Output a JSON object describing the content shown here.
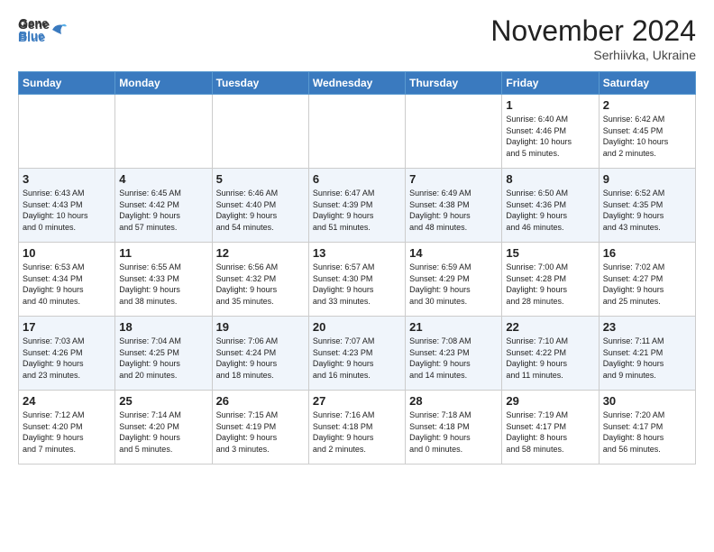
{
  "logo": {
    "general": "General",
    "blue": "Blue"
  },
  "title": "November 2024",
  "location": "Serhiivka, Ukraine",
  "headers": [
    "Sunday",
    "Monday",
    "Tuesday",
    "Wednesday",
    "Thursday",
    "Friday",
    "Saturday"
  ],
  "weeks": [
    [
      {
        "day": "",
        "info": ""
      },
      {
        "day": "",
        "info": ""
      },
      {
        "day": "",
        "info": ""
      },
      {
        "day": "",
        "info": ""
      },
      {
        "day": "",
        "info": ""
      },
      {
        "day": "1",
        "info": "Sunrise: 6:40 AM\nSunset: 4:46 PM\nDaylight: 10 hours\nand 5 minutes."
      },
      {
        "day": "2",
        "info": "Sunrise: 6:42 AM\nSunset: 4:45 PM\nDaylight: 10 hours\nand 2 minutes."
      }
    ],
    [
      {
        "day": "3",
        "info": "Sunrise: 6:43 AM\nSunset: 4:43 PM\nDaylight: 10 hours\nand 0 minutes."
      },
      {
        "day": "4",
        "info": "Sunrise: 6:45 AM\nSunset: 4:42 PM\nDaylight: 9 hours\nand 57 minutes."
      },
      {
        "day": "5",
        "info": "Sunrise: 6:46 AM\nSunset: 4:40 PM\nDaylight: 9 hours\nand 54 minutes."
      },
      {
        "day": "6",
        "info": "Sunrise: 6:47 AM\nSunset: 4:39 PM\nDaylight: 9 hours\nand 51 minutes."
      },
      {
        "day": "7",
        "info": "Sunrise: 6:49 AM\nSunset: 4:38 PM\nDaylight: 9 hours\nand 48 minutes."
      },
      {
        "day": "8",
        "info": "Sunrise: 6:50 AM\nSunset: 4:36 PM\nDaylight: 9 hours\nand 46 minutes."
      },
      {
        "day": "9",
        "info": "Sunrise: 6:52 AM\nSunset: 4:35 PM\nDaylight: 9 hours\nand 43 minutes."
      }
    ],
    [
      {
        "day": "10",
        "info": "Sunrise: 6:53 AM\nSunset: 4:34 PM\nDaylight: 9 hours\nand 40 minutes."
      },
      {
        "day": "11",
        "info": "Sunrise: 6:55 AM\nSunset: 4:33 PM\nDaylight: 9 hours\nand 38 minutes."
      },
      {
        "day": "12",
        "info": "Sunrise: 6:56 AM\nSunset: 4:32 PM\nDaylight: 9 hours\nand 35 minutes."
      },
      {
        "day": "13",
        "info": "Sunrise: 6:57 AM\nSunset: 4:30 PM\nDaylight: 9 hours\nand 33 minutes."
      },
      {
        "day": "14",
        "info": "Sunrise: 6:59 AM\nSunset: 4:29 PM\nDaylight: 9 hours\nand 30 minutes."
      },
      {
        "day": "15",
        "info": "Sunrise: 7:00 AM\nSunset: 4:28 PM\nDaylight: 9 hours\nand 28 minutes."
      },
      {
        "day": "16",
        "info": "Sunrise: 7:02 AM\nSunset: 4:27 PM\nDaylight: 9 hours\nand 25 minutes."
      }
    ],
    [
      {
        "day": "17",
        "info": "Sunrise: 7:03 AM\nSunset: 4:26 PM\nDaylight: 9 hours\nand 23 minutes."
      },
      {
        "day": "18",
        "info": "Sunrise: 7:04 AM\nSunset: 4:25 PM\nDaylight: 9 hours\nand 20 minutes."
      },
      {
        "day": "19",
        "info": "Sunrise: 7:06 AM\nSunset: 4:24 PM\nDaylight: 9 hours\nand 18 minutes."
      },
      {
        "day": "20",
        "info": "Sunrise: 7:07 AM\nSunset: 4:23 PM\nDaylight: 9 hours\nand 16 minutes."
      },
      {
        "day": "21",
        "info": "Sunrise: 7:08 AM\nSunset: 4:23 PM\nDaylight: 9 hours\nand 14 minutes."
      },
      {
        "day": "22",
        "info": "Sunrise: 7:10 AM\nSunset: 4:22 PM\nDaylight: 9 hours\nand 11 minutes."
      },
      {
        "day": "23",
        "info": "Sunrise: 7:11 AM\nSunset: 4:21 PM\nDaylight: 9 hours\nand 9 minutes."
      }
    ],
    [
      {
        "day": "24",
        "info": "Sunrise: 7:12 AM\nSunset: 4:20 PM\nDaylight: 9 hours\nand 7 minutes."
      },
      {
        "day": "25",
        "info": "Sunrise: 7:14 AM\nSunset: 4:20 PM\nDaylight: 9 hours\nand 5 minutes."
      },
      {
        "day": "26",
        "info": "Sunrise: 7:15 AM\nSunset: 4:19 PM\nDaylight: 9 hours\nand 3 minutes."
      },
      {
        "day": "27",
        "info": "Sunrise: 7:16 AM\nSunset: 4:18 PM\nDaylight: 9 hours\nand 2 minutes."
      },
      {
        "day": "28",
        "info": "Sunrise: 7:18 AM\nSunset: 4:18 PM\nDaylight: 9 hours\nand 0 minutes."
      },
      {
        "day": "29",
        "info": "Sunrise: 7:19 AM\nSunset: 4:17 PM\nDaylight: 8 hours\nand 58 minutes."
      },
      {
        "day": "30",
        "info": "Sunrise: 7:20 AM\nSunset: 4:17 PM\nDaylight: 8 hours\nand 56 minutes."
      }
    ]
  ]
}
